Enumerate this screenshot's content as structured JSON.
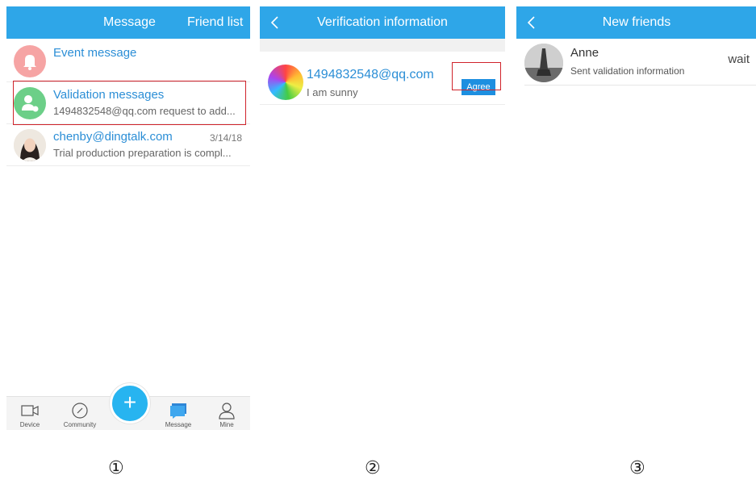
{
  "panel1": {
    "header": {
      "tab_message": "Message",
      "tab_friends": "Friend list"
    },
    "rows": [
      {
        "name": "Event message",
        "sub": "",
        "date": ""
      },
      {
        "name": "Validation messages",
        "sub": "1494832548@qq.com request to add...",
        "date": ""
      },
      {
        "name": "chenby@dingtalk.com",
        "sub": "Trial production preparation is compl...",
        "date": "3/14/18"
      }
    ],
    "nav": [
      {
        "label": "Device",
        "icon": "video-camera-icon"
      },
      {
        "label": "Community",
        "icon": "compass-icon"
      },
      {
        "label": "Message",
        "icon": "chat-bubble-icon"
      },
      {
        "label": "Mine",
        "icon": "person-icon"
      }
    ],
    "fab": "+"
  },
  "panel2": {
    "header": {
      "title": "Verification information"
    },
    "request": {
      "name": "1494832548@qq.com",
      "sub": "I am sunny",
      "button": "Agree"
    }
  },
  "panel3": {
    "header": {
      "title": "New friends"
    },
    "friend": {
      "name": "Anne",
      "sub": "Sent validation information",
      "status": "wait"
    }
  },
  "labels": {
    "one": "①",
    "two": "②",
    "three": "③"
  },
  "colors": {
    "header": "#2ea6e8",
    "link": "#2b8ed6",
    "highlight": "#d0232b",
    "fab": "#27b4f0"
  }
}
